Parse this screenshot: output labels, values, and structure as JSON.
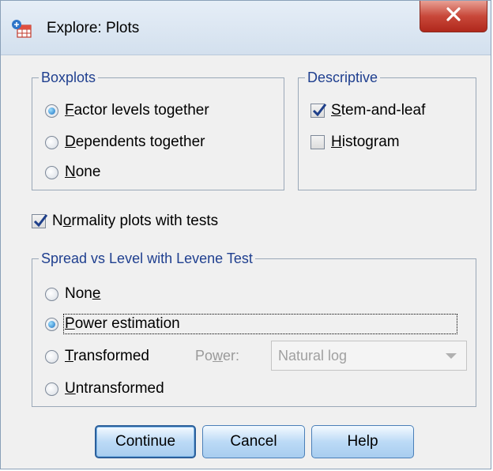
{
  "window": {
    "title": "Explore: Plots"
  },
  "boxplots": {
    "legend": "Boxplots",
    "options": [
      {
        "label": "Factor levels together",
        "mnemonic": "F",
        "rest": "actor levels together",
        "selected": true
      },
      {
        "label": "Dependents together",
        "mnemonic": "D",
        "rest": "ependents together",
        "selected": false
      },
      {
        "label": "None",
        "mnemonic": "N",
        "rest": "one",
        "selected": false
      }
    ]
  },
  "descriptive": {
    "legend": "Descriptive",
    "options": [
      {
        "label": "Stem-and-leaf",
        "mnemonic": "S",
        "rest": "tem-and-leaf",
        "checked": true
      },
      {
        "label": "Histogram",
        "mnemonic": "H",
        "rest": "istogram",
        "checked": false
      }
    ]
  },
  "normality": {
    "pre": "N",
    "mnemonic": "o",
    "rest": "rmality plots with tests",
    "checked": true
  },
  "spread": {
    "legend": "Spread vs Level with Levene Test",
    "none": {
      "pre": "Non",
      "mnemonic": "e",
      "rest": "",
      "selected": false
    },
    "power_estimation": {
      "pre": "",
      "mnemonic": "P",
      "rest": "ower estimation",
      "selected": true
    },
    "transformed": {
      "pre": "",
      "mnemonic": "T",
      "rest": "ransformed",
      "selected": false
    },
    "untransformed": {
      "pre": "",
      "mnemonic": "U",
      "rest": "ntransformed",
      "selected": false
    },
    "power_label": {
      "pre": "Po",
      "mnemonic": "w",
      "rest": "er:"
    },
    "power_value": "Natural log"
  },
  "buttons": {
    "continue": "Continue",
    "cancel": "Cancel",
    "help": "Help"
  },
  "colors": {
    "legend_text": "#1f3f8f",
    "button_fill": "#bcdaf6",
    "close_red": "#c8483a"
  }
}
